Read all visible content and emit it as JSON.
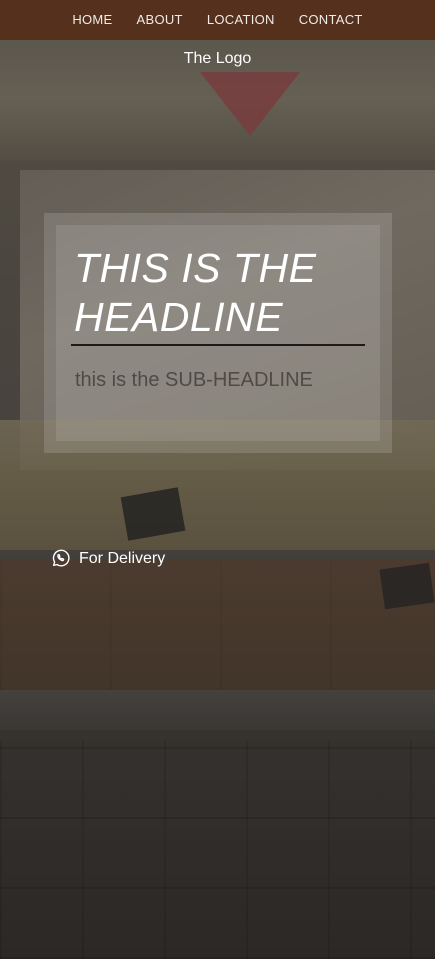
{
  "nav": {
    "items": [
      {
        "label": "HOME"
      },
      {
        "label": "ABOUT"
      },
      {
        "label": "LOCATION"
      },
      {
        "label": "CONTACT"
      }
    ]
  },
  "brand": {
    "logo_text": "The Logo"
  },
  "hero": {
    "headline_line1": "THIS IS THE",
    "headline_line2": "HEADLINE",
    "subheadline": "this is the SUB-HEADLINE"
  },
  "delivery": {
    "label": "For Delivery",
    "icon": "whatsapp-icon"
  },
  "colors": {
    "nav_bg": "#54301d",
    "divider": "#1f1a17",
    "subheadline": "#4f4a46"
  }
}
